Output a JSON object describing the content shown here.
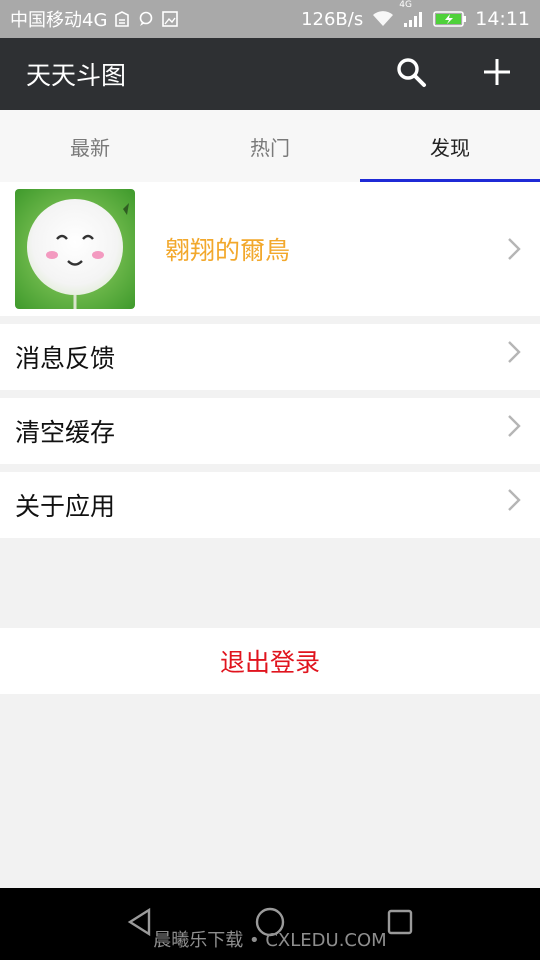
{
  "status_bar": {
    "carrier": "中国移动4G",
    "speed": "126B/s",
    "time": "14:11",
    "network": "4G",
    "icons": [
      "sim-icon",
      "chat-icon",
      "image-icon",
      "wifi-icon",
      "signal-icon",
      "battery-charging-icon"
    ]
  },
  "app_bar": {
    "title": "天天斗图",
    "actions": [
      "search-icon",
      "plus-icon"
    ]
  },
  "tabs": [
    {
      "label": "最新",
      "active": false
    },
    {
      "label": "热门",
      "active": false
    },
    {
      "label": "发现",
      "active": true
    }
  ],
  "profile": {
    "name": "翱翔的爾鳥",
    "avatar": "smiling-dandelion-avatar"
  },
  "menu": [
    {
      "label": "消息反馈"
    },
    {
      "label": "清空缓存"
    },
    {
      "label": "关于应用"
    }
  ],
  "logout_label": "退出登录",
  "nav_bar": {
    "buttons": [
      "back-icon",
      "home-icon",
      "recents-icon"
    ]
  },
  "watermark": "晨曦乐下载 • CXLEDU.COM",
  "colors": {
    "app_bar": "#2e3033",
    "tab_indicator": "#1f2ad6",
    "profile_name": "#f2a82c",
    "logout": "#e0141e"
  }
}
